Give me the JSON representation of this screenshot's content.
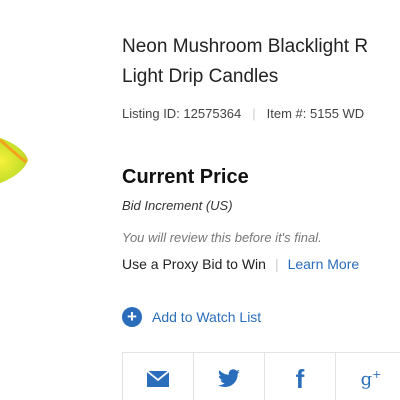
{
  "listing": {
    "title_line1": "Neon Mushroom Blacklight R",
    "title_line2": "Light Drip Candles",
    "listing_id_label": "Listing ID: 12575364",
    "item_number_label": "Item #: 5155 WD"
  },
  "price": {
    "heading": "Current Price",
    "bid_increment_label": "Bid Increment (US)",
    "review_note": "You will review this before it's final.",
    "proxy_text": "Use a Proxy Bid to Win",
    "learn_more": "Learn More"
  },
  "watch": {
    "label": "Add to Watch List"
  },
  "share": {
    "buttons": [
      {
        "icon": "envelope-icon"
      },
      {
        "icon": "twitter-icon"
      },
      {
        "icon": "facebook-icon",
        "glyph": "f"
      },
      {
        "icon": "google-plus-icon",
        "glyph": "g",
        "sup": "+"
      }
    ]
  },
  "colors": {
    "accent": "#2a6ebb",
    "text": "#222222",
    "muted": "#777777"
  }
}
